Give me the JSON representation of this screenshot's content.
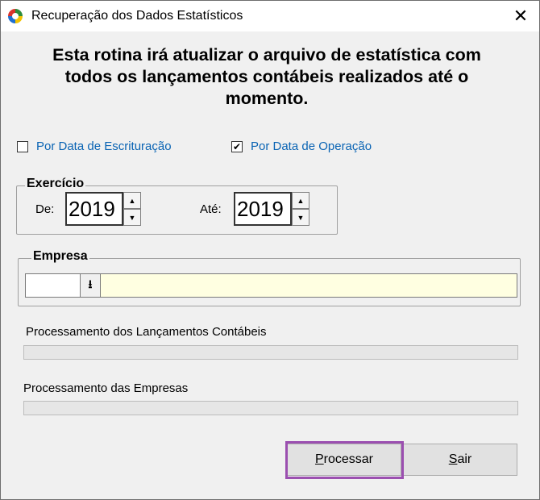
{
  "window": {
    "title": "Recuperação dos Dados Estatísticos",
    "close_glyph": "✕",
    "icon": "app-logo-icon"
  },
  "heading": {
    "line1": "Esta rotina irá atualizar o arquivo de estatística com",
    "line2": "todos os lançamentos contábeis realizados até o",
    "line3": "momento."
  },
  "options": {
    "escrituracao": {
      "label": "Por Data de Escrituração",
      "checked": false,
      "mark": ""
    },
    "operacao": {
      "label": "Por Data de Operação",
      "checked": true,
      "mark": "✔"
    }
  },
  "exercicio": {
    "legend": "Exercício",
    "from_label": "De:",
    "from_value": "2019",
    "to_label": "Até:",
    "to_value": "2019",
    "up_glyph": "▲",
    "down_glyph": "▼"
  },
  "empresa": {
    "legend": "Empresa",
    "code_value": "",
    "name_value": "",
    "dropdown_glyph": "⭳"
  },
  "progress": {
    "lancamentos_label": "Processamento dos Lançamentos Contábeis",
    "lancamentos_fraction": 0,
    "empresas_label": "Processamento das Empresas",
    "empresas_fraction": 0
  },
  "buttons": {
    "processar_mnemonic": "P",
    "processar_rest": "rocessar",
    "sair_mnemonic": "S",
    "sair_rest": "air"
  },
  "colors": {
    "accent_link": "#0a64b4",
    "company_field_bg": "#ffffe1",
    "highlight": "#9b4fb0"
  }
}
